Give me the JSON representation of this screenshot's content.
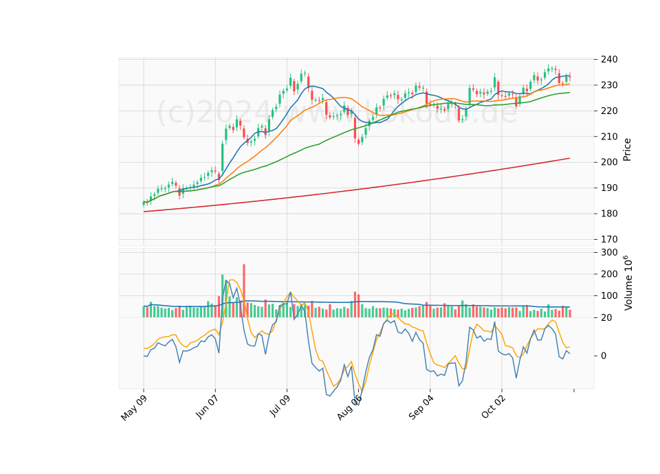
{
  "chart_data": {
    "type": "candlestick",
    "watermark": "(c)2024 www.kokodo.de",
    "dates": [
      "May 09",
      "May 10",
      "May 13",
      "May 14",
      "May 15",
      "May 16",
      "May 17",
      "May 20",
      "May 21",
      "May 22",
      "May 23",
      "May 24",
      "May 28",
      "May 29",
      "May 30",
      "May 31",
      "Jun 03",
      "Jun 04",
      "Jun 05",
      "Jun 06",
      "Jun 07",
      "Jun 10",
      "Jun 11",
      "Jun 12",
      "Jun 13",
      "Jun 14",
      "Jun 17",
      "Jun 18",
      "Jun 20",
      "Jun 21",
      "Jun 24",
      "Jun 25",
      "Jun 26",
      "Jun 27",
      "Jun 28",
      "Jul 01",
      "Jul 02",
      "Jul 03",
      "Jul 05",
      "Jul 08",
      "Jul 09",
      "Jul 10",
      "Jul 11",
      "Jul 12",
      "Jul 15",
      "Jul 16",
      "Jul 17",
      "Jul 18",
      "Jul 19",
      "Jul 22",
      "Jul 23",
      "Jul 24",
      "Jul 25",
      "Jul 26",
      "Jul 29",
      "Jul 30",
      "Jul 31",
      "Aug 01",
      "Aug 02",
      "Aug 05",
      "Aug 06",
      "Aug 07",
      "Aug 08",
      "Aug 09",
      "Aug 12",
      "Aug 13",
      "Aug 14",
      "Aug 15",
      "Aug 16",
      "Aug 19",
      "Aug 20",
      "Aug 21",
      "Aug 22",
      "Aug 23",
      "Aug 26",
      "Aug 27",
      "Aug 28",
      "Aug 29",
      "Aug 30",
      "Sep 03",
      "Sep 04",
      "Sep 05",
      "Sep 06",
      "Sep 09",
      "Sep 10",
      "Sep 11",
      "Sep 12",
      "Sep 13",
      "Sep 16",
      "Sep 17",
      "Sep 18",
      "Sep 19",
      "Sep 20",
      "Sep 23",
      "Sep 24",
      "Sep 25",
      "Sep 26",
      "Sep 27",
      "Sep 30",
      "Oct 01",
      "Oct 02",
      "Oct 03",
      "Oct 04",
      "Oct 07",
      "Oct 08",
      "Oct 09",
      "Oct 10",
      "Oct 11",
      "Oct 14",
      "Oct 15",
      "Oct 16",
      "Oct 17",
      "Oct 18",
      "Oct 21",
      "Oct 22",
      "Oct 23",
      "Oct 24",
      "Oct 25",
      "Oct 28",
      "Oct 29"
    ],
    "close": [
      184.6,
      184.3,
      186.7,
      187.6,
      189.7,
      189.8,
      189.9,
      191.3,
      192.4,
      190.9,
      187.0,
      189.9,
      189.9,
      190.3,
      191.3,
      192.2,
      194.0,
      194.3,
      195.9,
      196.9,
      196.4,
      193.1,
      207.2,
      213.1,
      214.2,
      212.5,
      216.7,
      214.3,
      209.7,
      207.5,
      208.1,
      209.1,
      213.3,
      214.1,
      210.6,
      216.8,
      220.3,
      221.6,
      226.3,
      227.8,
      228.7,
      232.9,
      227.6,
      230.5,
      234.4,
      234.8,
      228.9,
      224.3,
      224.3,
      223.96,
      225.0,
      218.5,
      217.5,
      217.96,
      218.2,
      218.8,
      222.1,
      218.4,
      219.9,
      209.3,
      207.2,
      209.8,
      213.3,
      216.2,
      217.5,
      221.3,
      221.2,
      224.7,
      226.05,
      225.9,
      226.8,
      224.5,
      224.5,
      226.8,
      227.2,
      226.5,
      229.8,
      229.0,
      229.0,
      222.8,
      222.4,
      222.4,
      220.8,
      220.9,
      220.1,
      222.7,
      222.8,
      222.5,
      216.3,
      216.8,
      220.7,
      228.9,
      228.2,
      226.5,
      227.4,
      226.4,
      227.5,
      227.8,
      233.0,
      226.2,
      225.8,
      225.7,
      226.8,
      226.5,
      221.7,
      225.8,
      229.0,
      227.6,
      231.3,
      233.9,
      231.8,
      232.2,
      235.0,
      236.5,
      236.5,
      235.9,
      230.8,
      230.6,
      233.4,
      233.2
    ],
    "volume_unit": "10^6",
    "volume": [
      50,
      47,
      72,
      52,
      52,
      45,
      41,
      44,
      34,
      43,
      53,
      35,
      52,
      54,
      46,
      45,
      50,
      48,
      75,
      64,
      56,
      98,
      198,
      172,
      97,
      70,
      93,
      79,
      246,
      69,
      66,
      57,
      51,
      49,
      82,
      60,
      63,
      37,
      57,
      72,
      67,
      48,
      62,
      53,
      62,
      59,
      54,
      76,
      44,
      49,
      41,
      36,
      61,
      36,
      42,
      40,
      49,
      41,
      76,
      119,
      106,
      61,
      43,
      40,
      52,
      43,
      42,
      45,
      44,
      41,
      38,
      36,
      40,
      33,
      39,
      44,
      46,
      52,
      57,
      71,
      56,
      40,
      45,
      46,
      65,
      52,
      51,
      37,
      52,
      78,
      61,
      46,
      60,
      50,
      49,
      46,
      43,
      36,
      46,
      42,
      46,
      42,
      47,
      45,
      46,
      30,
      51,
      57,
      29,
      35,
      30,
      40,
      27,
      61,
      35,
      39,
      31,
      54,
      47,
      35
    ]
  },
  "panels": {
    "price": {
      "ylabel": "Price",
      "ticks": [
        "170",
        "180",
        "190",
        "200",
        "210",
        "220",
        "230",
        "240"
      ]
    },
    "volume": {
      "ylabel": "Volume  10",
      "ylabel_sup": "6",
      "ticks": [
        "100",
        "200",
        "300"
      ]
    },
    "indicator": {
      "ticks": [
        "0",
        "20"
      ]
    }
  },
  "x_ticks": [
    "May 09",
    "Jun 07",
    "Jul 09",
    "Aug 06",
    "Sep 04",
    "Oct 02"
  ],
  "colors": {
    "up": "#26c281",
    "down": "#ff4d4d",
    "ma_fast": "#1f77b4",
    "ma_mid": "#ff7f0e",
    "ma_slow": "#2ca02c",
    "ma_long": "#d62728",
    "vol_ma": "#1f77b4",
    "ind_a": "#ffa500",
    "ind_b": "#4682b4",
    "panel_bg": "#fafafa",
    "grid": "#d3d3d3"
  }
}
